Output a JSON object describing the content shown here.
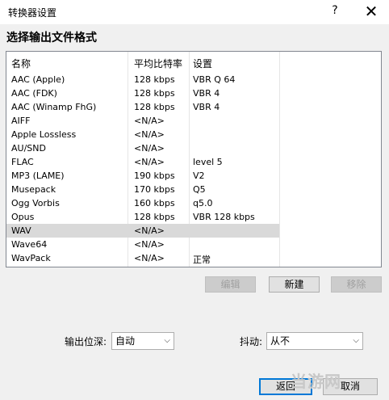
{
  "window": {
    "title": "转换器设置",
    "help_glyph": "?",
    "close_glyph": "✕"
  },
  "heading": "选择输出文件格式",
  "table": {
    "headers": [
      "名称",
      "平均比特率",
      "设置"
    ],
    "rows": [
      {
        "name": "AAC (Apple)",
        "bitrate": "128 kbps",
        "setting": "VBR Q 64"
      },
      {
        "name": "AAC (FDK)",
        "bitrate": "128 kbps",
        "setting": "VBR 4"
      },
      {
        "name": "AAC (Winamp FhG)",
        "bitrate": "128 kbps",
        "setting": "VBR 4"
      },
      {
        "name": "AIFF",
        "bitrate": "<N/A>",
        "setting": ""
      },
      {
        "name": "Apple Lossless",
        "bitrate": "<N/A>",
        "setting": ""
      },
      {
        "name": "AU/SND",
        "bitrate": "<N/A>",
        "setting": ""
      },
      {
        "name": "FLAC",
        "bitrate": "<N/A>",
        "setting": "level 5"
      },
      {
        "name": "MP3 (LAME)",
        "bitrate": "190 kbps",
        "setting": "V2"
      },
      {
        "name": "Musepack",
        "bitrate": "170 kbps",
        "setting": "Q5"
      },
      {
        "name": "Ogg Vorbis",
        "bitrate": "160 kbps",
        "setting": "q5.0"
      },
      {
        "name": "Opus",
        "bitrate": "128 kbps",
        "setting": "VBR 128 kbps"
      },
      {
        "name": "WAV",
        "bitrate": "<N/A>",
        "setting": ""
      },
      {
        "name": "Wave64",
        "bitrate": "<N/A>",
        "setting": ""
      },
      {
        "name": "WavPack",
        "bitrate": "<N/A>",
        "setting": "正常"
      }
    ],
    "selected_row": "WAV"
  },
  "buttons": {
    "edit": "编辑",
    "new": "新建",
    "remove": "移除",
    "back": "返回",
    "cancel": "取消"
  },
  "output_depth": {
    "label": "输出位深:",
    "value": "自动"
  },
  "dither": {
    "label": "抖动:",
    "value": "从不"
  },
  "watermark": "当游网"
}
